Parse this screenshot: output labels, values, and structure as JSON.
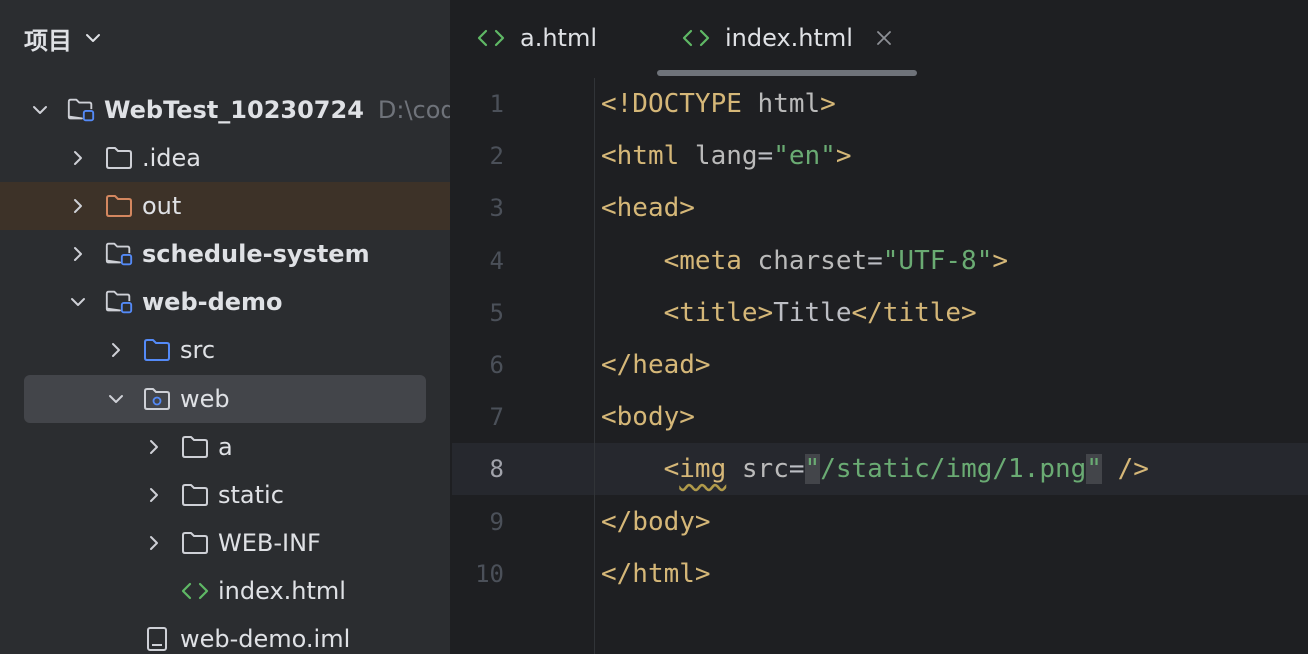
{
  "sidebar": {
    "title": "项目",
    "tree": [
      {
        "label": "WebTest_10230724",
        "hint": "D:\\cod",
        "bold": true,
        "expanded": true,
        "icon": "module-folder-icon"
      },
      {
        "label": ".idea",
        "bold": false,
        "expanded": false,
        "icon": "folder-icon"
      },
      {
        "label": "out",
        "bold": false,
        "expanded": false,
        "icon": "excluded-folder-icon"
      },
      {
        "label": "schedule-system",
        "bold": true,
        "expanded": false,
        "icon": "module-folder-icon"
      },
      {
        "label": "web-demo",
        "bold": true,
        "expanded": true,
        "icon": "module-folder-icon"
      },
      {
        "label": "src",
        "bold": false,
        "expanded": false,
        "icon": "source-folder-icon"
      },
      {
        "label": "web",
        "bold": false,
        "expanded": true,
        "icon": "web-folder-icon"
      },
      {
        "label": "a",
        "bold": false,
        "expanded": false,
        "icon": "folder-icon"
      },
      {
        "label": "static",
        "bold": false,
        "expanded": false,
        "icon": "folder-icon"
      },
      {
        "label": "WEB-INF",
        "bold": false,
        "expanded": false,
        "icon": "folder-icon"
      },
      {
        "label": "index.html",
        "bold": false,
        "icon": "html-file-icon"
      },
      {
        "label": "web-demo.iml",
        "bold": false,
        "icon": "iml-file-icon"
      }
    ]
  },
  "tabs": [
    {
      "label": "a.html",
      "active": false,
      "icon": "html-file-icon"
    },
    {
      "label": "index.html",
      "active": true,
      "icon": "html-file-icon",
      "close": "×"
    }
  ],
  "editor": {
    "line_numbers": [
      "1",
      "2",
      "3",
      "4",
      "5",
      "6",
      "7",
      "8",
      "9",
      "10"
    ],
    "current_line": 8,
    "lines": [
      [
        {
          "t": "tag",
          "s": "<!DOCTYPE "
        },
        {
          "t": "attr",
          "s": "html"
        },
        {
          "t": "tag",
          "s": ">"
        }
      ],
      [
        {
          "t": "tag",
          "s": "<html "
        },
        {
          "t": "attr",
          "s": "lang"
        },
        {
          "t": "txt",
          "s": "="
        },
        {
          "t": "str",
          "s": "\"en\""
        },
        {
          "t": "tag",
          "s": ">"
        }
      ],
      [
        {
          "t": "tag",
          "s": "<head>"
        }
      ],
      [
        {
          "t": "txt",
          "s": "    "
        },
        {
          "t": "tag",
          "s": "<meta "
        },
        {
          "t": "attr",
          "s": "charset"
        },
        {
          "t": "txt",
          "s": "="
        },
        {
          "t": "str",
          "s": "\"UTF-8\""
        },
        {
          "t": "tag",
          "s": ">"
        }
      ],
      [
        {
          "t": "txt",
          "s": "    "
        },
        {
          "t": "tag",
          "s": "<title>"
        },
        {
          "t": "txt",
          "s": "Title"
        },
        {
          "t": "tag",
          "s": "</title>"
        }
      ],
      [
        {
          "t": "tag",
          "s": "</head>"
        }
      ],
      [
        {
          "t": "tag",
          "s": "<body>"
        }
      ],
      [
        {
          "t": "txt",
          "s": "    "
        },
        {
          "t": "tag",
          "s": "<"
        },
        {
          "t": "tag-squiggle",
          "s": "img"
        },
        {
          "t": "tag",
          "s": " "
        },
        {
          "t": "attr",
          "s": "src"
        },
        {
          "t": "txt",
          "s": "="
        },
        {
          "t": "str-hl",
          "s": "\""
        },
        {
          "t": "str",
          "s": "/static/img/1.png"
        },
        {
          "t": "str-hl",
          "s": "\""
        },
        {
          "t": "tag",
          "s": " />"
        }
      ],
      [
        {
          "t": "tag",
          "s": "</body>"
        }
      ],
      [
        {
          "t": "tag",
          "s": "</html>"
        }
      ]
    ]
  },
  "colors": {
    "sidebar_bg": "#2b2d30",
    "editor_bg": "#1e1f22",
    "tag": "#d5b778",
    "string": "#6aab73",
    "attr": "#bababa",
    "excluded_folder": "#d4875f",
    "source_folder": "#548af7",
    "html_icon": "#5fb865"
  }
}
